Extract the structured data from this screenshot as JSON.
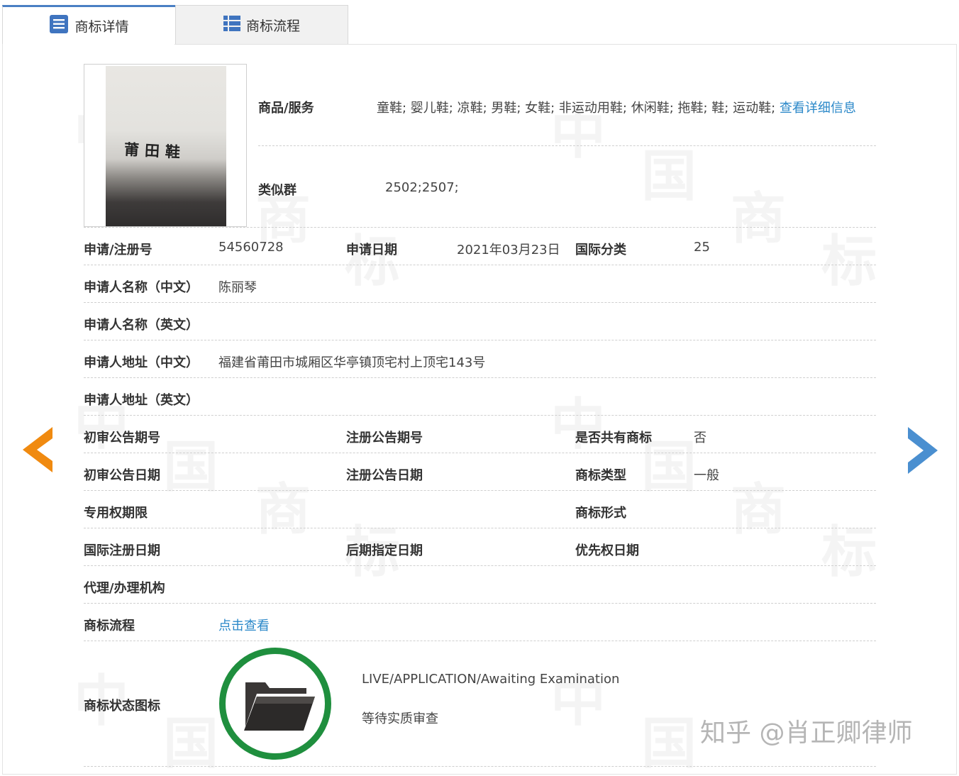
{
  "tabs": {
    "detail": "商标详情",
    "flow": "商标流程"
  },
  "image": {
    "mark_text": "莆田鞋"
  },
  "goods": {
    "label": "商品/服务",
    "value": "童鞋; 婴儿鞋; 凉鞋; 男鞋; 女鞋; 非运动用鞋; 休闲鞋; 拖鞋; 鞋; 运动鞋;",
    "more_link": "查看详细信息"
  },
  "similar_group": {
    "label": "类似群",
    "value": "2502;2507;"
  },
  "fields": {
    "reg_no_label": "申请/注册号",
    "reg_no": "54560728",
    "apply_date_label": "申请日期",
    "apply_date": "2021年03月23日",
    "intl_class_label": "国际分类",
    "intl_class": "25",
    "applicant_cn_label": "申请人名称（中文）",
    "applicant_cn": "陈丽琴",
    "applicant_en_label": "申请人名称（英文）",
    "address_cn_label": "申请人地址（中文）",
    "address_cn": "福建省莆田市城厢区华亭镇顶宅村上顶宅143号",
    "address_en_label": "申请人地址（英文）",
    "prelim_pub_no_label": "初审公告期号",
    "reg_pub_no_label": "注册公告期号",
    "shared_label": "是否共有商标",
    "shared": "否",
    "prelim_pub_date_label": "初审公告日期",
    "reg_pub_date_label": "注册公告日期",
    "tm_type_label": "商标类型",
    "tm_type": "一般",
    "exclusive_period_label": "专用权期限",
    "tm_form_label": "商标形式",
    "intl_reg_date_label": "国际注册日期",
    "later_designation_label": "后期指定日期",
    "priority_date_label": "优先权日期",
    "agent_label": "代理/办理机构",
    "flow_label": "商标流程",
    "flow_link": "点击查看",
    "status_icon_label": "商标状态图标"
  },
  "status": {
    "en": "LIVE/APPLICATION/Awaiting Examination",
    "cn": "等待实质审查"
  },
  "watermark": {
    "chars": "中国商标"
  },
  "credit": "知乎 @肖正卿律师",
  "icons": {
    "left_arrow": "chevron-left-icon",
    "right_arrow": "chevron-right-icon",
    "status": "folder-open-icon"
  },
  "colors": {
    "left_arrow": "#f08a10",
    "right_arrow": "#4a8fd0",
    "link": "#2b88c9",
    "status_ring": "#1f8f3e"
  }
}
